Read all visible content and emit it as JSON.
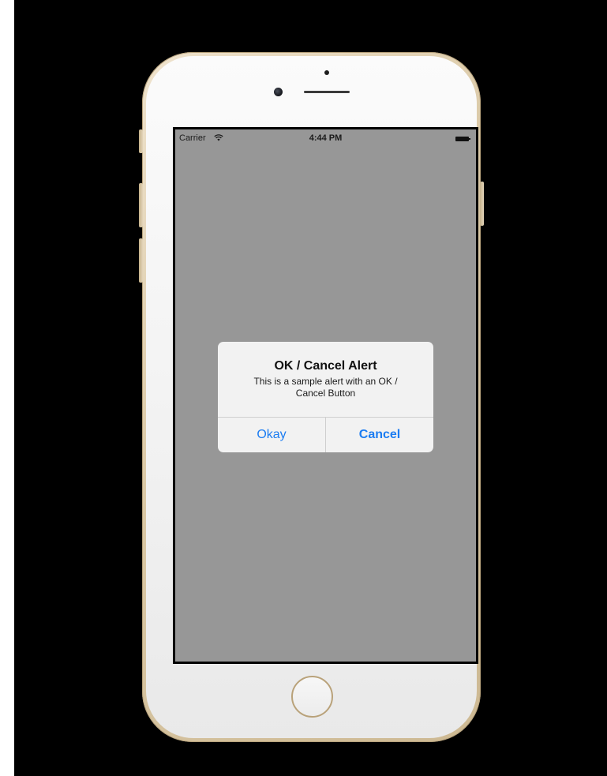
{
  "status_bar": {
    "carrier": "Carrier",
    "time": "4:44 PM",
    "wifi_icon": "wifi-icon",
    "battery_icon": "battery-icon"
  },
  "alert": {
    "title": "OK / Cancel Alert",
    "message": "This is a sample alert with an OK / Cancel Button",
    "buttons": {
      "okay": "Okay",
      "cancel": "Cancel"
    }
  },
  "colors": {
    "screen_background": "#979797",
    "alert_background": "#f2f2f2",
    "button_tint": "#1b7cf2",
    "phone_frame": "#d9c7a4",
    "stage_background": "#000000"
  }
}
